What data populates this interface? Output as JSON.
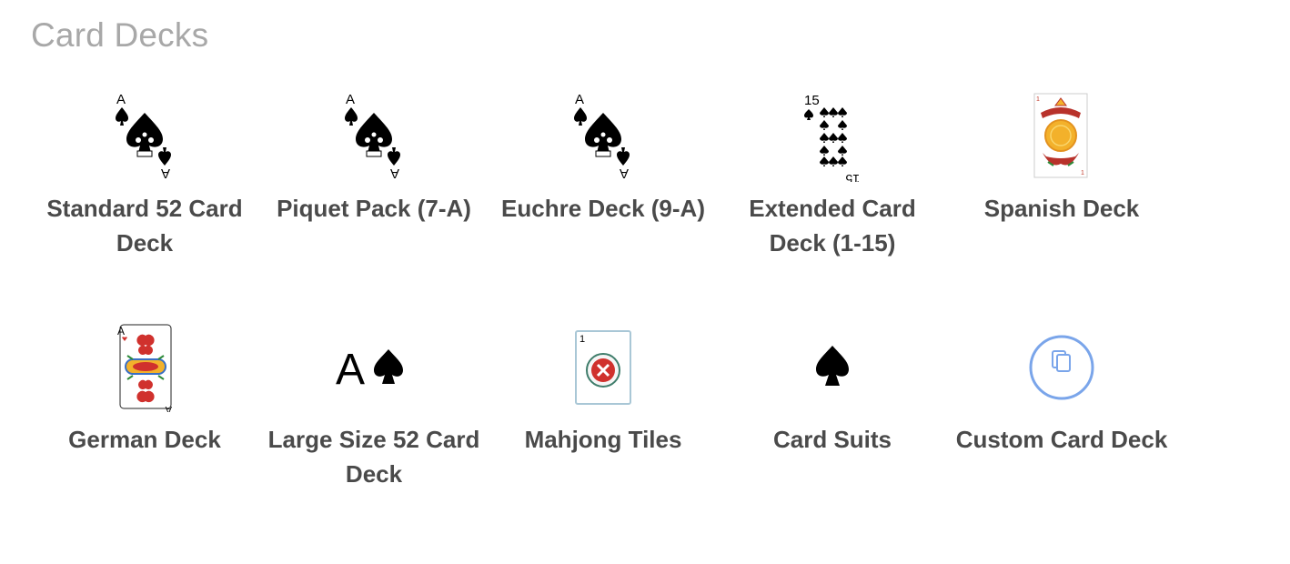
{
  "page": {
    "title": "Card Decks"
  },
  "decks": [
    {
      "label": "Standard 52 Card Deck",
      "icon": "ace-of-spades-card-icon"
    },
    {
      "label": "Piquet Pack (7-A)",
      "icon": "ace-of-spades-card-icon"
    },
    {
      "label": "Euchre Deck (9-A)",
      "icon": "ace-of-spades-card-icon"
    },
    {
      "label": "Extended Card Deck (1-15)",
      "icon": "fifteen-of-spades-card-icon"
    },
    {
      "label": "Spanish Deck",
      "icon": "spanish-card-icon"
    },
    {
      "label": "German Deck",
      "icon": "german-ace-of-hearts-card-icon"
    },
    {
      "label": "Large Size 52 Card Deck",
      "icon": "large-ace-spade-icon"
    },
    {
      "label": "Mahjong Tiles",
      "icon": "mahjong-tile-icon"
    },
    {
      "label": "Card Suits",
      "icon": "spade-suit-icon"
    },
    {
      "label": "Custom Card Deck",
      "icon": "custom-deck-icon"
    }
  ],
  "card_text": {
    "ace_rank": "A",
    "fifteen_rank": "15",
    "tile_number": "1",
    "spanish_index": "1",
    "large_rank": "A"
  },
  "colors": {
    "title": "#a8a8a8",
    "label": "#4a4a4a",
    "spade": "#000000",
    "heart": "#d0312d",
    "accent_blue": "#7aa5ea",
    "tile_border": "#a9c7d6",
    "gold": "#f3b12b"
  }
}
